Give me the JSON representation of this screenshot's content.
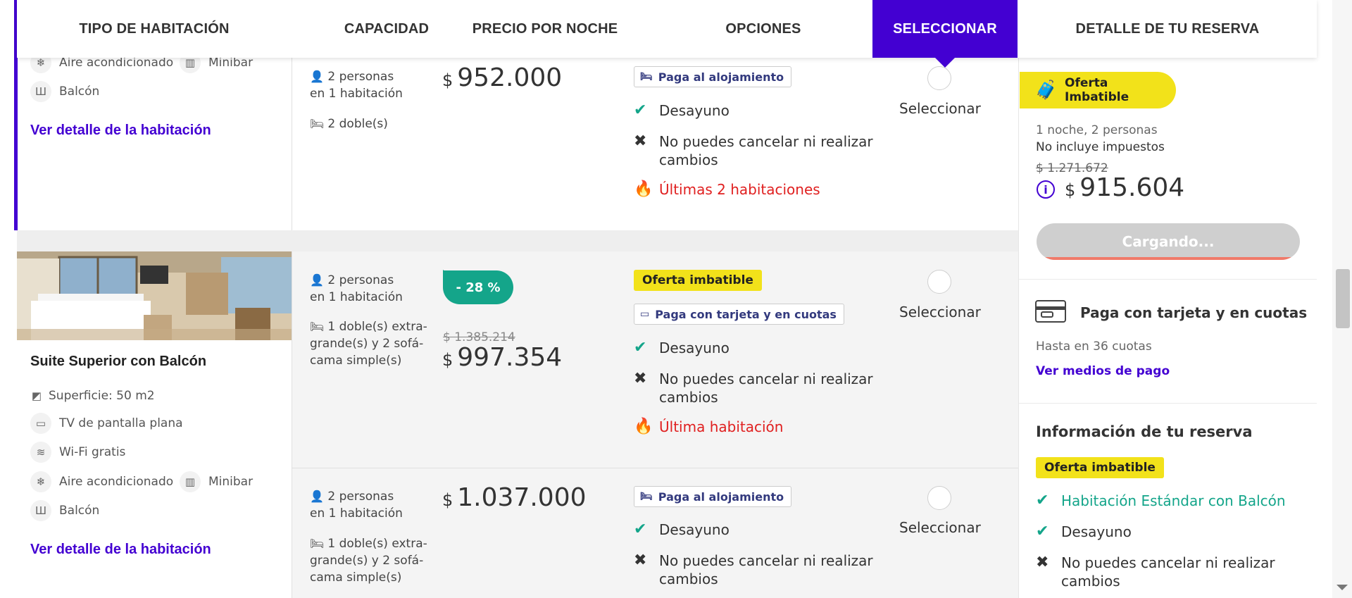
{
  "header": {
    "columns": [
      "TIPO DE HABITACIÓN",
      "CAPACIDAD",
      "PRECIO POR NOCHE",
      "OPCIONES",
      "SELECCIONAR",
      "DETALLE DE TU RESERVA"
    ]
  },
  "room1": {
    "amenities": [
      "Aire acondicionado",
      "Minibar",
      "Balcón"
    ],
    "detail_link": "Ver detalle de la habitación",
    "option1": {
      "capacity": "2 personas",
      "rooms": "en 1 habitación",
      "beds": "2 doble(s)",
      "price_currency": "$",
      "price": "952.000",
      "tag": "Paga al alojamiento",
      "breakfast": "Desayuno",
      "cancel": "No puedes cancelar ni realizar cambios",
      "availability": "Últimas 2 habitaciones",
      "select_label": "Seleccionar"
    }
  },
  "room2": {
    "name": "Suite Superior con Balcón",
    "surface": "Superficie: 50 m2",
    "amenities": [
      "TV de pantalla plana",
      "Wi-Fi gratis",
      "Aire acondicionado",
      "Minibar",
      "Balcón"
    ],
    "detail_link": "Ver detalle de la habitación",
    "option1": {
      "capacity": "2 personas",
      "rooms": "en 1 habitación",
      "beds": "1 doble(s) extra-grande(s) y 2 sofá-cama simple(s)",
      "discount": "- 28 %",
      "old_price": "$ 1.385.214",
      "price_currency": "$",
      "price": "997.354",
      "badge": "Oferta imbatible",
      "tag": "Paga con tarjeta y en cuotas",
      "breakfast": "Desayuno",
      "cancel": "No puedes cancelar ni realizar cambios",
      "availability": "Última habitación",
      "select_label": "Seleccionar"
    },
    "option2": {
      "capacity": "2 personas",
      "rooms": "en 1 habitación",
      "beds": "1 doble(s) extra-grande(s) y 2 sofá-cama simple(s)",
      "price_currency": "$",
      "price": "1.037.000",
      "tag": "Paga al alojamiento",
      "breakfast": "Desayuno",
      "cancel": "No puedes cancelar ni realizar cambios",
      "select_label": "Seleccionar"
    }
  },
  "summary": {
    "badge": "Oferta Imbatible",
    "stay": "1 noche, 2 personas",
    "taxes": "No incluye impuestos",
    "old_price": "$ 1.271.672",
    "price_currency": "$",
    "price": "915.604",
    "button": "Cargando...",
    "payment_title": "Paga con tarjeta y en cuotas",
    "payment_sub": "Hasta en 36 cuotas",
    "payment_link": "Ver medios de pago",
    "info_title": "Información de tu reserva",
    "info_badge": "Oferta imbatible",
    "info_room": "Habitación Estándar con Balcón",
    "info_breakfast": "Desayuno",
    "info_cancel": "No puedes cancelar ni realizar cambios"
  },
  "colors": {
    "accent": "#4300d2",
    "green": "#14a58a",
    "yellow": "#f2e21a",
    "red": "#e02020"
  }
}
